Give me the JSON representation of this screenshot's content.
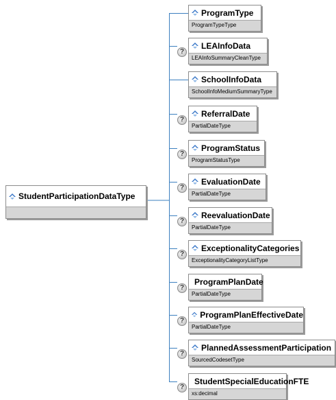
{
  "root": {
    "name": "StudentParticipationDataType",
    "icon": "element-icon"
  },
  "children": [
    {
      "name": "ProgramType",
      "type": "ProgramTypeType",
      "help": false,
      "icon": "element-icon"
    },
    {
      "name": "LEAInfoData",
      "type": "LEAInfoSummaryCleanType",
      "help": true,
      "icon": "element-icon"
    },
    {
      "name": "SchoolInfoData",
      "type": "SchoolInfoMediumSummaryType",
      "help": false,
      "icon": "element-icon"
    },
    {
      "name": "ReferralDate",
      "type": "PartialDateType",
      "help": true,
      "icon": "element-icon"
    },
    {
      "name": "ProgramStatus",
      "type": "ProgramStatusType",
      "help": true,
      "icon": "element-icon"
    },
    {
      "name": "EvaluationDate",
      "type": "PartialDateType",
      "help": true,
      "icon": "element-icon"
    },
    {
      "name": "ReevaluationDate",
      "type": "PartialDateType",
      "help": true,
      "icon": "element-icon"
    },
    {
      "name": "ExceptionalityCategories",
      "type": "ExceptionalityCategoryListType",
      "help": true,
      "icon": "element-icon"
    },
    {
      "name": "ProgramPlanDate",
      "type": "PartialDateType",
      "help": true,
      "icon": "element-icon"
    },
    {
      "name": "ProgramPlanEffectiveDate",
      "type": "PartialDateType",
      "help": true,
      "icon": "element-icon"
    },
    {
      "name": "PlannedAssessmentParticipation",
      "type": "SourcedCodesetType",
      "help": true,
      "icon": "element-icon"
    },
    {
      "name": "StudentSpecialEducationFTE",
      "type": "xs:decimal",
      "help": true,
      "icon": "element-icon"
    }
  ],
  "help_symbol": "?",
  "colors": {
    "icon": "#3a78c8",
    "connector": "#3b7fbf",
    "type_bar": "#d6d6d6"
  }
}
